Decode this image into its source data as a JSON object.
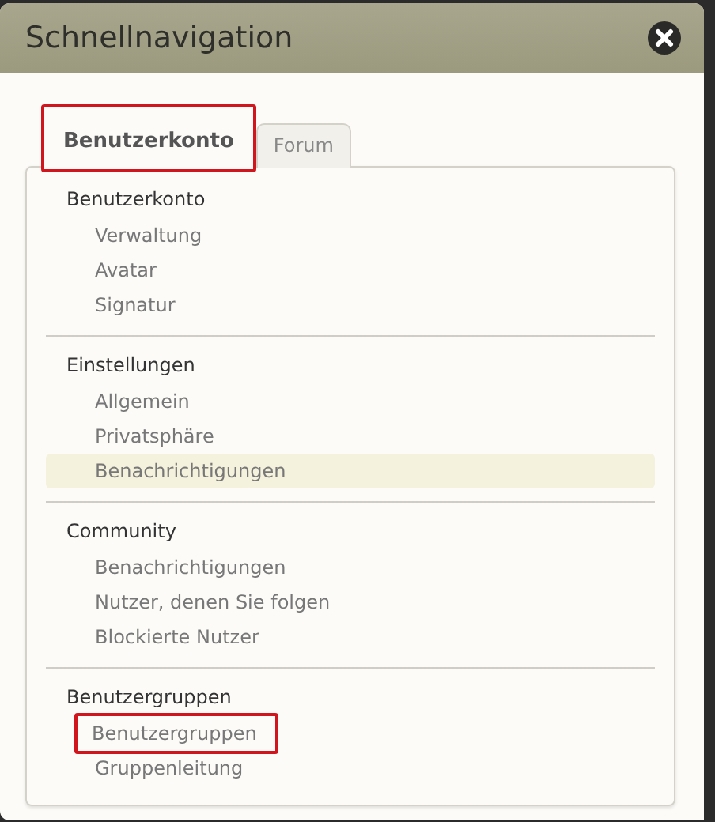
{
  "window": {
    "title": "Schnellnavigation"
  },
  "tabs": [
    {
      "label": "Benutzerkonto",
      "selected": true,
      "marked": true
    },
    {
      "label": "Forum",
      "selected": false,
      "marked": false
    }
  ],
  "sections": [
    {
      "title": "Benutzerkonto",
      "items": [
        {
          "label": "Verwaltung",
          "selected": false,
          "marked": false
        },
        {
          "label": "Avatar",
          "selected": false,
          "marked": false
        },
        {
          "label": "Signatur",
          "selected": false,
          "marked": false
        }
      ]
    },
    {
      "title": "Einstellungen",
      "items": [
        {
          "label": "Allgemein",
          "selected": false,
          "marked": false
        },
        {
          "label": "Privatsphäre",
          "selected": false,
          "marked": false
        },
        {
          "label": "Benachrichtigungen",
          "selected": true,
          "marked": false
        }
      ]
    },
    {
      "title": "Community",
      "items": [
        {
          "label": "Benachrichtigungen",
          "selected": false,
          "marked": false
        },
        {
          "label": "Nutzer, denen Sie folgen",
          "selected": false,
          "marked": false
        },
        {
          "label": "Blockierte Nutzer",
          "selected": false,
          "marked": false
        }
      ]
    },
    {
      "title": "Benutzergruppen",
      "items": [
        {
          "label": "Benutzergruppen",
          "selected": false,
          "marked": true
        },
        {
          "label": "Gruppenleitung",
          "selected": false,
          "marked": false
        }
      ]
    }
  ]
}
